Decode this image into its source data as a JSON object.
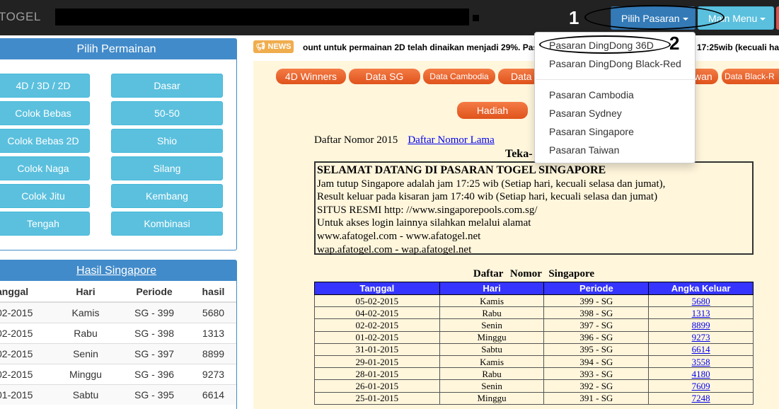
{
  "navbar": {
    "brand": "TOGEL",
    "pilih_pasaran": "Pilih Pasaran",
    "main_menu": "Main Menu"
  },
  "annotations": {
    "one": "1",
    "two": "2"
  },
  "permainan": {
    "title": "Pilih Permainan",
    "left": [
      "4D / 3D / 2D",
      "Colok Bebas",
      "Colok Bebas 2D",
      "Colok Naga",
      "Colok Jitu",
      "Tengah"
    ],
    "right": [
      "Dasar",
      "50-50",
      "Shio",
      "Silang",
      "Kembang",
      "Kombinasi"
    ]
  },
  "hasil": {
    "title": "Hasil Singapore",
    "headers": [
      "anggal",
      "Hari",
      "Periode",
      "hasil"
    ],
    "rows": [
      [
        "02-2015",
        "Kamis",
        "SG - 399",
        "5680"
      ],
      [
        "02-2015",
        "Rabu",
        "SG - 398",
        "1313"
      ],
      [
        "02-2015",
        "Senin",
        "SG - 397",
        "8899"
      ],
      [
        "02-2015",
        "Minggu",
        "SG - 396",
        "9273"
      ],
      [
        "01-2015",
        "Sabtu",
        "SG - 395",
        "6614"
      ]
    ]
  },
  "news": {
    "badge": "NEWS",
    "text": "ount untuk permainan 2D telah dinaikan menjadi 29%. Pas",
    "text_right": "17:25wib (kecuali ha"
  },
  "tabs": [
    "4D Winners",
    "Data SG",
    "Data Cambodia",
    "Data",
    "wan",
    "Data Black-R"
  ],
  "hadiah": "Hadiah",
  "daftar": {
    "label": "Daftar Nomor 2015",
    "link": "Daftar Nomor Lama",
    "teka": "Teka-"
  },
  "info": {
    "heading": "SELAMAT DATANG DI PASARAN TOGEL SINGAPORE",
    "lines": [
      "Jam tutup Singapore adalah jam 17:25 wib (Setiap hari, kecuali selasa dan jumat),",
      "Result keluar pada kisaran jam 17:40 wib (Setiap hari, kecuali selasa dan jumat)",
      "SITUS RESMI http: //www.singaporepools.com.sg/",
      "Untuk akses login lainnya silahkan melalui alamat",
      "www.afatogel.com - www.afatogel.net",
      "wap.afatogel.com - wap.afatogel.net"
    ]
  },
  "results": {
    "title": "Daftar Nomor Singapore",
    "headers": [
      "Tanggal",
      "Hari",
      "Periode",
      "Angka Keluar"
    ],
    "rows": [
      [
        "05-02-2015",
        "Kamis",
        "399 - SG",
        "5680"
      ],
      [
        "04-02-2015",
        "Rabu",
        "398 - SG",
        "1313"
      ],
      [
        "02-02-2015",
        "Senin",
        "397 - SG",
        "8899"
      ],
      [
        "01-02-2015",
        "Minggu",
        "396 - SG",
        "9273"
      ],
      [
        "31-01-2015",
        "Sabtu",
        "395 - SG",
        "6614"
      ],
      [
        "29-01-2015",
        "Kamis",
        "394 - SG",
        "3558"
      ],
      [
        "28-01-2015",
        "Rabu",
        "393 - SG",
        "4180"
      ],
      [
        "26-01-2015",
        "Senin",
        "392 - SG",
        "7609"
      ],
      [
        "25-01-2015",
        "Minggu",
        "391 - SG",
        "7248"
      ]
    ]
  },
  "dropdown": {
    "items_top": [
      "Pasaran DingDong 36D",
      "Pasaran DingDong Black-Red"
    ],
    "items_bottom": [
      "Pasaran Cambodia",
      "Pasaran Sydney",
      "Pasaran Singapore",
      "Pasaran Taiwan"
    ]
  },
  "colors": {
    "navbar": "#222222",
    "primary": "#337ab7",
    "info": "#5bc0de",
    "tab_orange": "#e8622a",
    "content_bg": "#fff6dc",
    "table_header": "#3535ff"
  }
}
